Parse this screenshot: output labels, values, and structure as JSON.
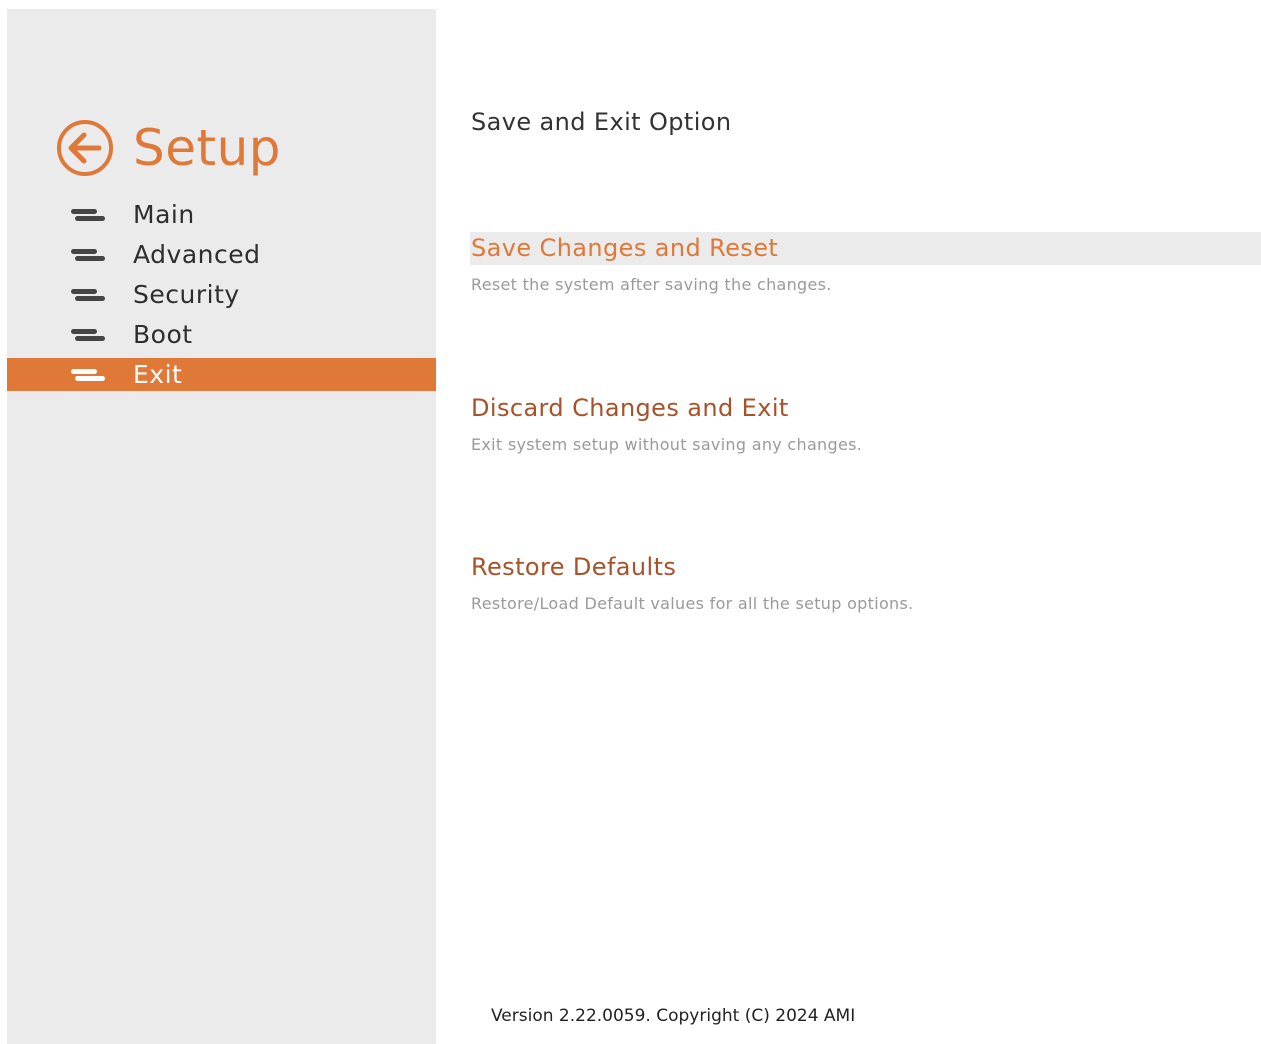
{
  "sidebar": {
    "title": "Setup",
    "back_icon": "back-arrow-circle-icon",
    "items": [
      {
        "label": "Main",
        "icon": "menu-lines-icon",
        "active": false
      },
      {
        "label": "Advanced",
        "icon": "menu-lines-icon",
        "active": false
      },
      {
        "label": "Security",
        "icon": "menu-lines-icon",
        "active": false
      },
      {
        "label": "Boot",
        "icon": "menu-lines-icon",
        "active": false
      },
      {
        "label": "Exit",
        "icon": "menu-lines-icon",
        "active": true
      }
    ]
  },
  "main": {
    "title": "Save and Exit Option",
    "options": [
      {
        "title": "Save Changes and Reset",
        "description": "Reset the system after saving the changes.",
        "selected": true
      },
      {
        "title": "Discard Changes and Exit",
        "description": "Exit system setup without saving any changes.",
        "selected": false
      },
      {
        "title": "Restore Defaults",
        "description": "Restore/Load Default values for all the setup options.",
        "selected": false
      }
    ]
  },
  "footer": {
    "version": "Version 2.22.0059. Copyright (C) 2024 AMI"
  },
  "colors": {
    "accent": "#e07838",
    "option_title": "#a8522a",
    "sidebar_bg": "#ebebeb",
    "description": "#9a9a9a"
  }
}
